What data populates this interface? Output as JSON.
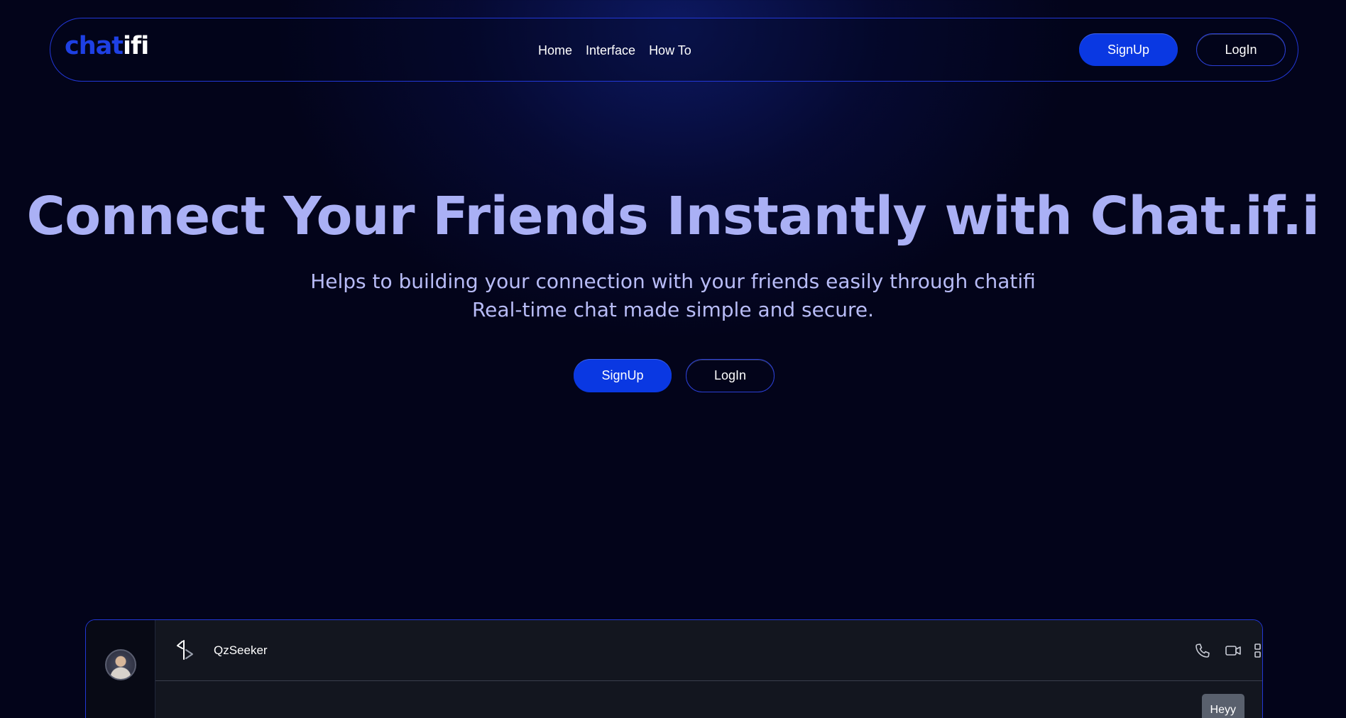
{
  "brand": {
    "part1": "chat",
    "part2": "ifi"
  },
  "nav": {
    "links": [
      "Home",
      "Interface",
      "How To"
    ],
    "signup_label": "SignUp",
    "login_label": "LogIn"
  },
  "hero": {
    "title": "Connect Your Friends Instantly with Chat.if.i",
    "subtitle_line1": "Helps to building your connection with your friends easily through chatifi",
    "subtitle_line2": "Real-time chat made simple and secure.",
    "signup_label": "SignUp",
    "login_label": "LogIn"
  },
  "chat_preview": {
    "contact_name": "QzSeeker",
    "message": "Heyy",
    "icons": [
      "back-icon",
      "phone-icon",
      "video-icon",
      "list-icon"
    ]
  },
  "colors": {
    "accent": "#0a38e2",
    "border": "#2237d6",
    "hero_text": "#aab0f5",
    "background": "#03041a"
  }
}
